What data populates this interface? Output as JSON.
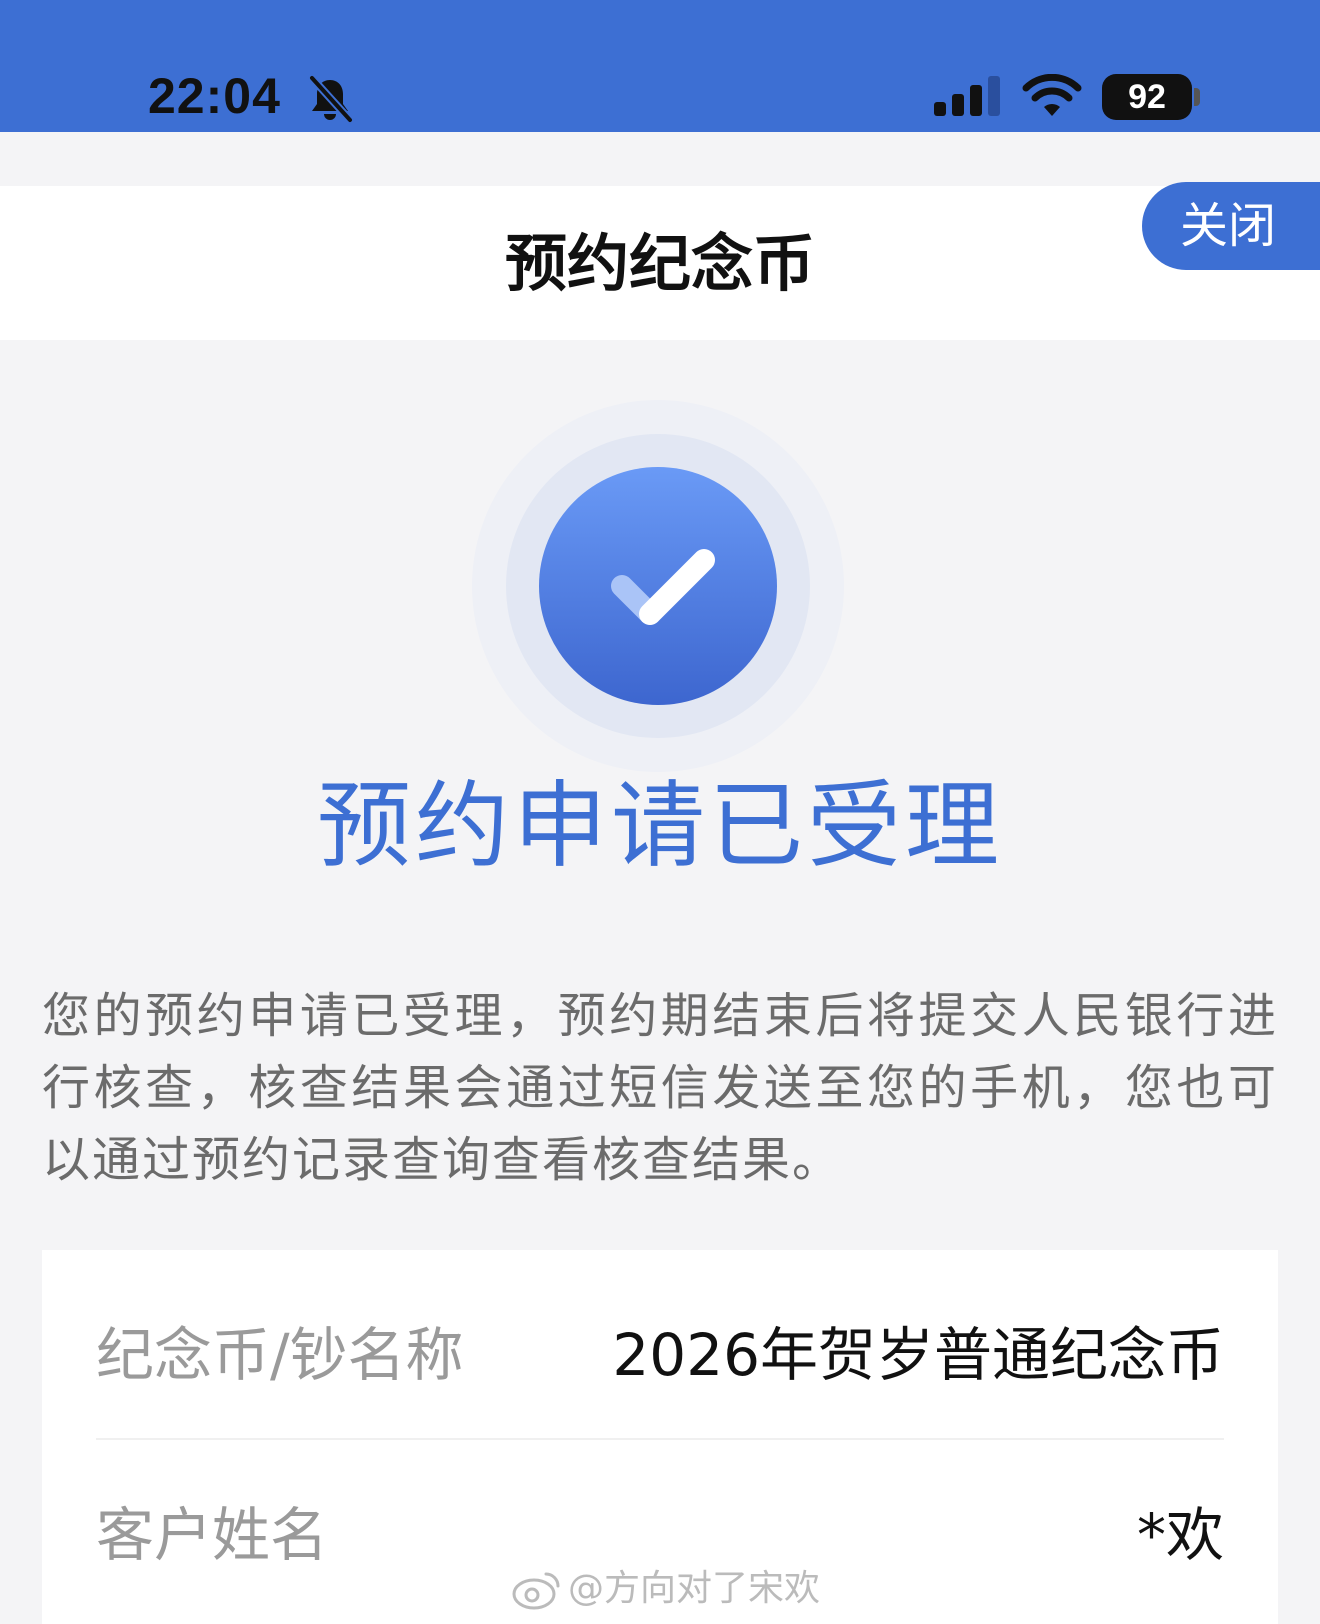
{
  "status_bar": {
    "time": "22:04",
    "battery": "92"
  },
  "header": {
    "title": "预约纪念币",
    "close_label": "关闭"
  },
  "result": {
    "title": "预约申请已受理",
    "description": "您的预约申请已受理，预约期结束后将提交人民银行进行核查，核查结果会通过短信发送至您的手机，您也可以通过预约记录查询查看核查结果。"
  },
  "info": {
    "rows": [
      {
        "label": "纪念币/钞名称",
        "value": "2026年贺岁普通纪念币"
      },
      {
        "label": "客户姓名",
        "value": "*欢"
      }
    ]
  },
  "watermark": {
    "text": "@方向对了宋欢"
  },
  "colors": {
    "accent": "#3d6fd3",
    "background": "#f4f4f6"
  }
}
